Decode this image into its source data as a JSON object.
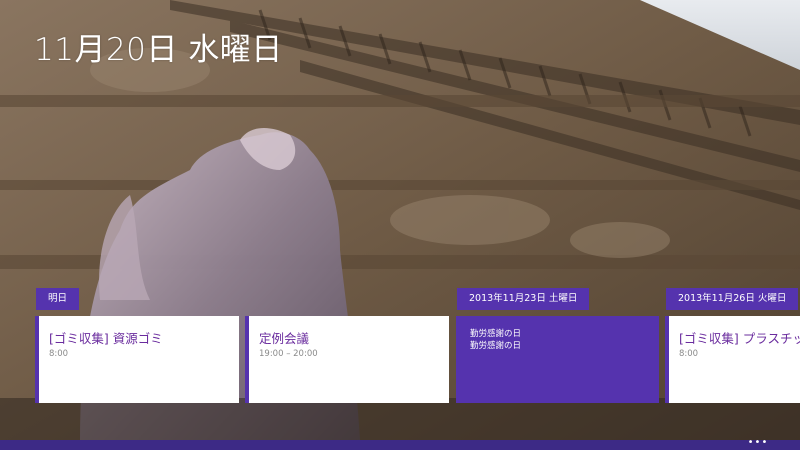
{
  "header": {
    "date": "11月20日 水曜日"
  },
  "groups": [
    {
      "header": "明日",
      "events": [
        {
          "title": "[ゴミ収集] 資源ゴミ",
          "time": "8:00"
        },
        {
          "title": "定例会議",
          "time": "19:00 – 20:00"
        }
      ]
    },
    {
      "header": "2013年11月23日 土曜日",
      "events": [
        {
          "lines": [
            "勤労感謝の日",
            "勤労感謝の日"
          ]
        }
      ]
    },
    {
      "header": "2013年11月26日 火曜日",
      "events": [
        {
          "title": "[ゴミ収集] プラスチック",
          "time": "8:00"
        }
      ]
    }
  ],
  "appbar": {
    "more_label": "•••"
  },
  "colors": {
    "accent": "#5533ae",
    "event_title": "#6a2c9e",
    "appbar": "#3d2a86"
  }
}
